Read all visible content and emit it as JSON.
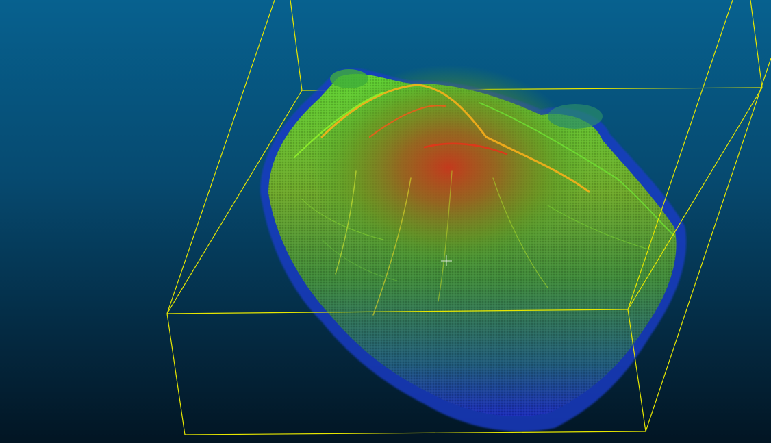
{
  "viewer": {
    "background_top": "#07618f",
    "background_bottom": "#021523",
    "bounding_box_color": "#e6e600",
    "cursor": "crosshair-icon"
  },
  "point_cloud": {
    "color_scale": [
      "#1a2cd8",
      "#1f8a8a",
      "#3fd23a",
      "#b7e41a",
      "#f0a21a",
      "#e8321a"
    ]
  }
}
